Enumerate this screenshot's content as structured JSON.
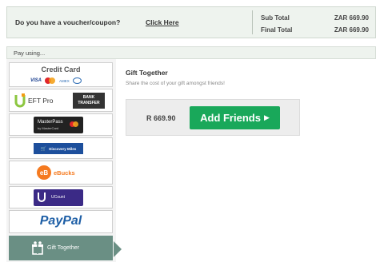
{
  "voucher": {
    "question": "Do you have a voucher/coupon?",
    "link": "Click Here"
  },
  "totals": {
    "subtotal_label": "Sub Total",
    "subtotal_value": "ZAR 669.90",
    "final_label": "Final Total",
    "final_value": "ZAR 669.90"
  },
  "pay_using": {
    "label": "Pay using..."
  },
  "methods": [
    {
      "label": "Credit Card",
      "badges": [
        "VISA",
        "MasterCard",
        "AMEX",
        "Diners"
      ]
    },
    {
      "label": "EFT Pro",
      "badge": "BANK TRANSFER"
    },
    {
      "label": "MasterPass",
      "sub": "by MasterCard"
    },
    {
      "label": "Discovery Miles"
    },
    {
      "label": "eBucks"
    },
    {
      "label": "UCount"
    },
    {
      "label": "PayPal"
    },
    {
      "label": "Gift Together",
      "active": true
    }
  ],
  "gift_together": {
    "title": "Gift Together",
    "subtitle": "Share the cost of your gift amongst friends!",
    "price": "R 669.90",
    "button": "Add Friends"
  },
  "colors": {
    "accent_green": "#19a85a",
    "active_method": "#6a8f84",
    "bar_bg": "#eef3ee"
  }
}
